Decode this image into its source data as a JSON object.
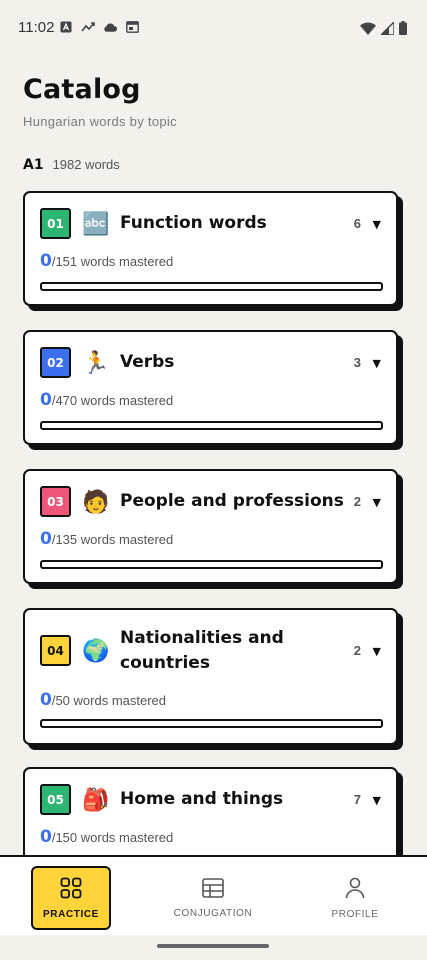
{
  "status_bar": {
    "time": "11:02",
    "left_icons": [
      "a-icon",
      "trend-icon",
      "cloud-icon",
      "window-icon"
    ],
    "right_icons": [
      "wifi-icon",
      "signal-icon",
      "battery-icon"
    ]
  },
  "header": {
    "title": "Catalog",
    "subtitle": "Hungarian words by topic"
  },
  "level": {
    "badge": "A1",
    "count": "1982 words"
  },
  "cards": [
    {
      "number": "01",
      "color": "#2DB573",
      "emoji": "🔤",
      "title": "Function words",
      "sub_count": "6",
      "mastered": "0",
      "total_text": "/151 words mastered",
      "progress": 0
    },
    {
      "number": "02",
      "color": "#3C6EF0",
      "emoji": "🏃",
      "title": "Verbs",
      "sub_count": "3",
      "mastered": "0",
      "total_text": "/470 words mastered",
      "progress": 0
    },
    {
      "number": "03",
      "color": "#F0567A",
      "emoji": "🧑",
      "title": "People and professions",
      "sub_count": "2",
      "mastered": "0",
      "total_text": "/135 words mastered",
      "progress": 0
    },
    {
      "number": "04",
      "color": "#FFD43B",
      "emoji": "🌍",
      "title": "Nationalities and countries",
      "sub_count": "2",
      "mastered": "0",
      "total_text": "/50 words mastered",
      "progress": 0
    },
    {
      "number": "05",
      "color": "#2DB573",
      "emoji": "🎒",
      "title": "Home and things",
      "sub_count": "7",
      "mastered": "0",
      "total_text": "/150 words mastered",
      "progress": 0
    }
  ],
  "bottom_nav": [
    {
      "label": "PRACTICE",
      "icon": "grid-icon",
      "active": true
    },
    {
      "label": "CONJUGATION",
      "icon": "table-icon",
      "active": false
    },
    {
      "label": "PROFILE",
      "icon": "person-icon",
      "active": false
    }
  ]
}
